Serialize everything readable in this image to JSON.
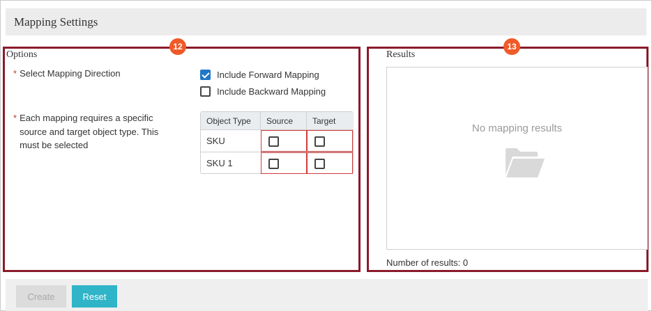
{
  "header": {
    "title": "Mapping Settings"
  },
  "markers": {
    "options": "12",
    "results": "13"
  },
  "options": {
    "title": "Options",
    "required_star": "*",
    "direction_label": "Select Mapping Direction",
    "forward_label": "Include Forward Mapping",
    "forward_checked": true,
    "backward_label": "Include Backward Mapping",
    "backward_checked": false,
    "object_type_note": "Each mapping requires a specific source and target object type. This must be selected",
    "table": {
      "headers": [
        "Object Type",
        "Source",
        "Target"
      ],
      "rows": [
        {
          "name": "SKU",
          "source": false,
          "target": false
        },
        {
          "name": "SKU 1",
          "source": false,
          "target": false
        }
      ]
    }
  },
  "results": {
    "title": "Results",
    "empty_text": "No mapping results",
    "empty_icon": "folder-open-icon",
    "count_text": "Number of results: 0"
  },
  "footer": {
    "create_label": "Create",
    "reset_label": "Reset"
  },
  "colors": {
    "panel_border": "#8b1a2a",
    "marker": "#f05a28",
    "checkbox_checked": "#1f77c9",
    "reset_button": "#2fb4c8",
    "required_star": "#c0392b"
  }
}
